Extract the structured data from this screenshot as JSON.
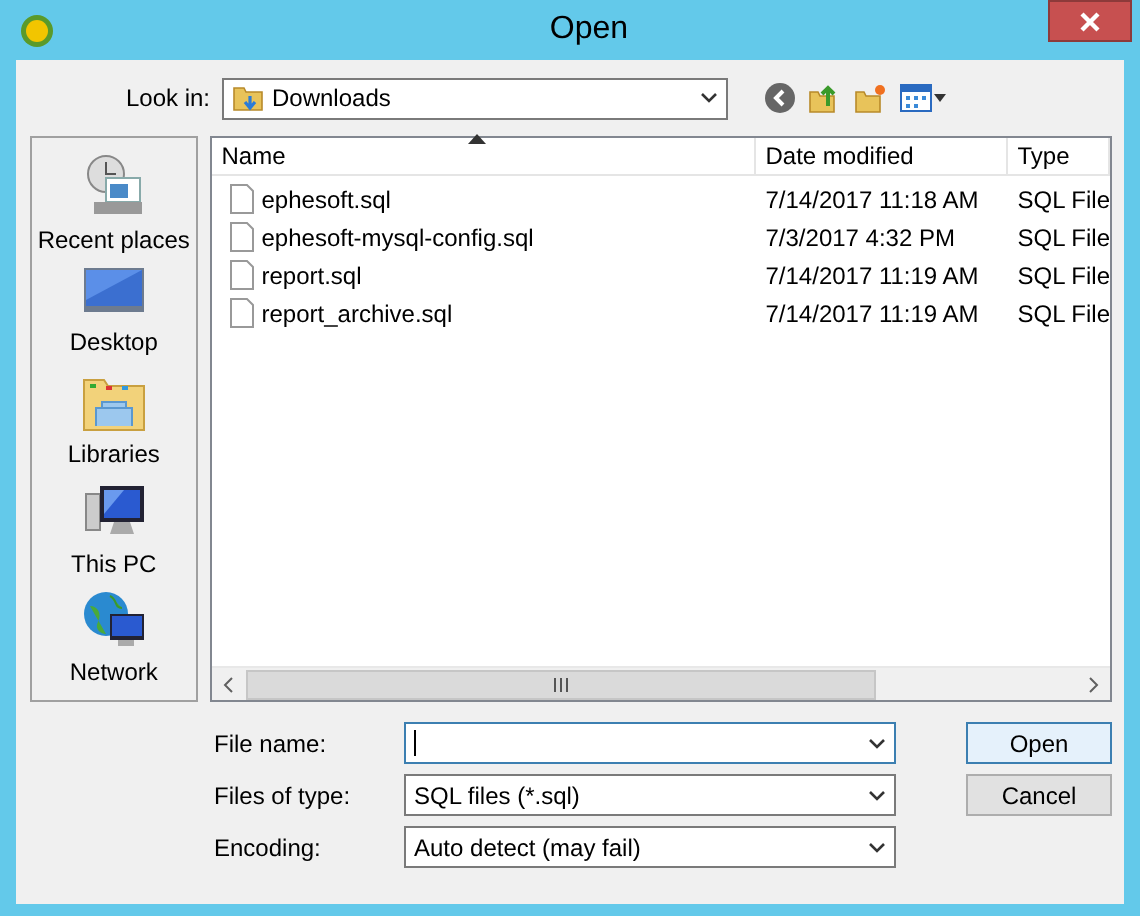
{
  "window": {
    "title": "Open"
  },
  "look_in": {
    "label": "Look in:",
    "value": "Downloads"
  },
  "places": [
    {
      "label": "Recent places",
      "kind": "recent"
    },
    {
      "label": "Desktop",
      "kind": "desktop"
    },
    {
      "label": "Libraries",
      "kind": "libraries"
    },
    {
      "label": "This PC",
      "kind": "pc"
    },
    {
      "label": "Network",
      "kind": "network"
    }
  ],
  "table": {
    "columns": [
      {
        "label": "Name",
        "sorted": true
      },
      {
        "label": "Date modified",
        "sorted": false
      },
      {
        "label": "Type",
        "sorted": false
      }
    ],
    "rows": [
      {
        "name": "ephesoft.sql",
        "date": "7/14/2017 11:18 AM",
        "type": "SQL File"
      },
      {
        "name": "ephesoft-mysql-config.sql",
        "date": "7/3/2017 4:32 PM",
        "type": "SQL File"
      },
      {
        "name": "report.sql",
        "date": "7/14/2017 11:19 AM",
        "type": "SQL File"
      },
      {
        "name": "report_archive.sql",
        "date": "7/14/2017 11:19 AM",
        "type": "SQL File"
      }
    ]
  },
  "fields": [
    {
      "label": "File name:",
      "focused": true
    },
    {
      "label": "Files of type:",
      "value": "SQL files (*.sql)",
      "focused": false
    },
    {
      "label": "Encoding:",
      "value": "Auto detect (may fail)",
      "focused": false
    }
  ],
  "buttons": [
    {
      "label": "Open",
      "default": true
    },
    {
      "label": "Cancel",
      "default": false
    }
  ]
}
